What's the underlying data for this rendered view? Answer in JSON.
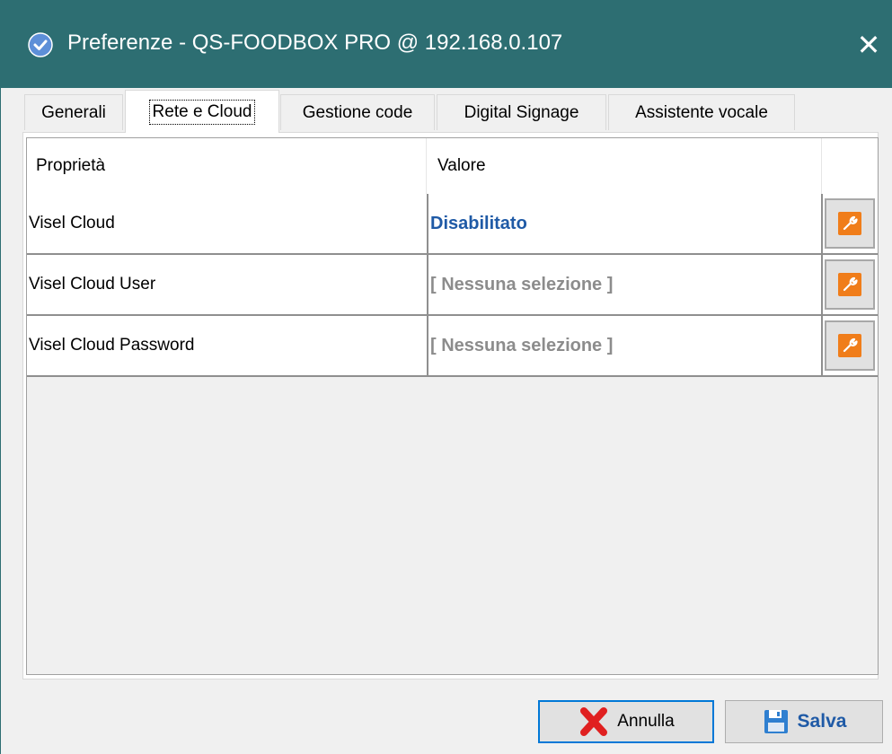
{
  "window": {
    "title": "Preferenze - QS-FOODBOX PRO @ 192.168.0.107",
    "close_label": "✕",
    "titlebar_color": "#2d6e72"
  },
  "tabs": [
    {
      "label": "Generali",
      "active": false
    },
    {
      "label": "Rete e Cloud",
      "active": true
    },
    {
      "label": "Gestione code",
      "active": false
    },
    {
      "label": "Digital Signage",
      "active": false
    },
    {
      "label": "Assistente vocale",
      "active": false
    }
  ],
  "grid": {
    "headers": {
      "property": "Proprietà",
      "value": "Valore"
    },
    "rows": [
      {
        "name": "Visel Cloud",
        "value": "Disabilitato",
        "icon": "wrench-icon"
      },
      {
        "name": "Visel Cloud User",
        "value": "[ Nessuna selezione ]",
        "icon": "wrench-icon"
      },
      {
        "name": "Visel Cloud Password",
        "value": "[ Nessuna selezione ]",
        "icon": "wrench-icon"
      }
    ]
  },
  "buttons": {
    "cancel": {
      "label": "Annulla",
      "icon": "cancel-x-icon"
    },
    "save": {
      "label": "Salva",
      "icon": "floppy-disk-icon"
    }
  },
  "colors": {
    "accent_orange": "#f07d1a",
    "value_blue": "#1f5aa6",
    "placeholder_gray": "#8c8c8c"
  }
}
